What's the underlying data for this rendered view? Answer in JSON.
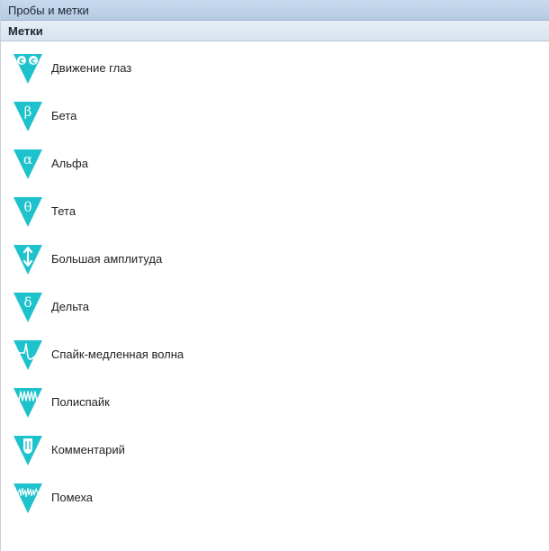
{
  "panel": {
    "title": "Пробы и метки",
    "section": "Метки"
  },
  "colors": {
    "accent": "#1ec2cc",
    "title_bar": "#c3d6ec",
    "section_header": "#dfe8f2"
  },
  "items": [
    {
      "label": "Движение глаз",
      "icon": "eye-movement-icon",
      "glyph": "cc"
    },
    {
      "label": "Бета",
      "icon": "beta-icon",
      "glyph": "β"
    },
    {
      "label": "Альфа",
      "icon": "alpha-icon",
      "glyph": "α"
    },
    {
      "label": "Тета",
      "icon": "theta-icon",
      "glyph": "θ"
    },
    {
      "label": "Большая амплитуда",
      "icon": "large-amplitude-icon",
      "glyph": "↕"
    },
    {
      "label": "Дельта",
      "icon": "delta-icon",
      "glyph": "δ"
    },
    {
      "label": "Спайк-медленная волна",
      "icon": "spike-slow-wave-icon",
      "glyph": ""
    },
    {
      "label": "Полиспайк",
      "icon": "polyspike-icon",
      "glyph": ""
    },
    {
      "label": "Комментарий",
      "icon": "comment-icon",
      "glyph": ""
    },
    {
      "label": "Помеха",
      "icon": "artifact-icon",
      "glyph": ""
    }
  ]
}
